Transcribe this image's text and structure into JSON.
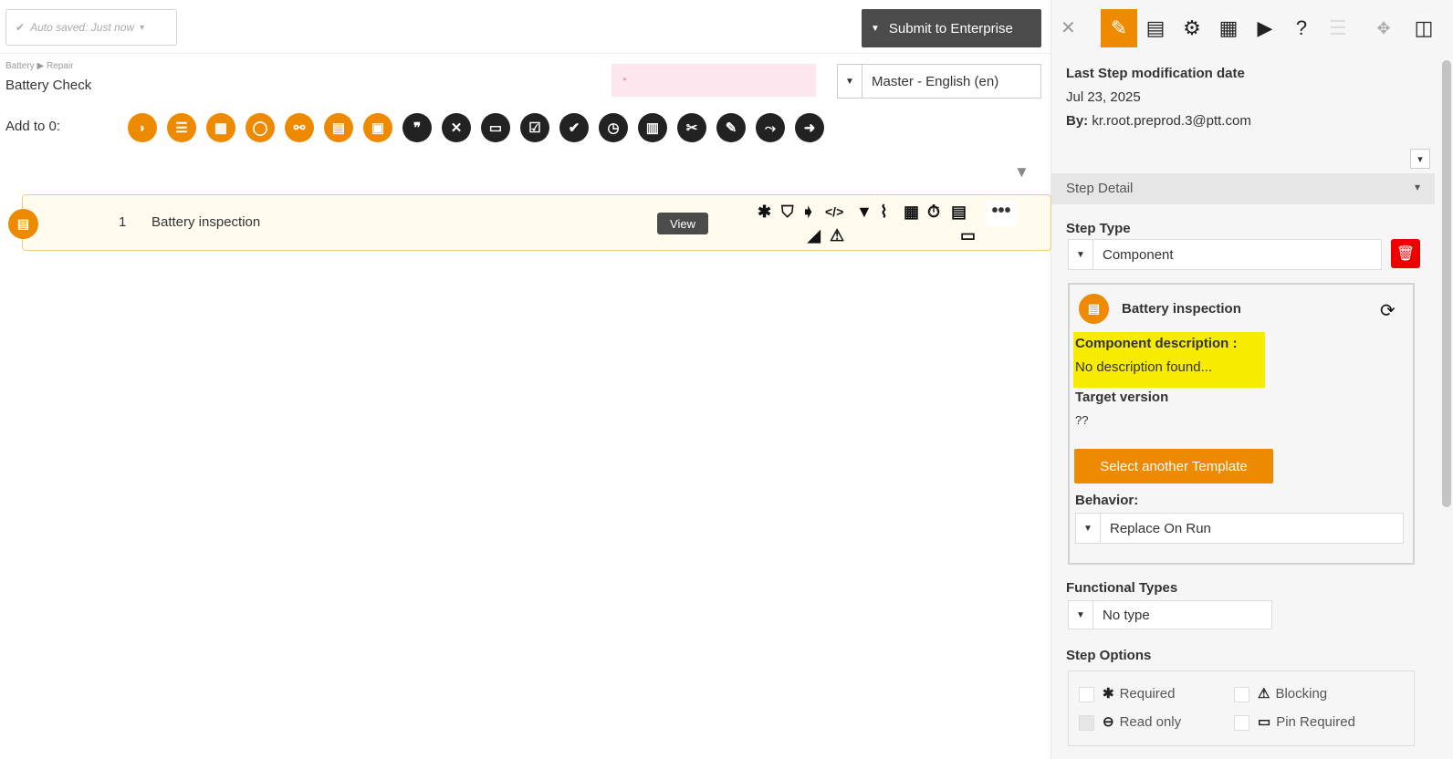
{
  "header": {
    "autosave_text": "Auto saved: Just now",
    "submit_label": "Submit to Enterprise"
  },
  "doc": {
    "breadcrumb": [
      "Battery",
      "Repair"
    ],
    "title": "Battery Check",
    "language": "Master - English (en)",
    "add_to_label": "Add to 0:"
  },
  "toolbar_icons": [
    {
      "name": "half-circle-icon",
      "glyph": "◗",
      "style": "o"
    },
    {
      "name": "list-icon",
      "glyph": "☰",
      "style": "o"
    },
    {
      "name": "table-icon",
      "glyph": "▦",
      "style": "o"
    },
    {
      "name": "circle-icon",
      "glyph": "◯",
      "style": "o"
    },
    {
      "name": "link-icon",
      "glyph": "⚯",
      "style": "o"
    },
    {
      "name": "calculator-icon",
      "glyph": "▤",
      "style": "o"
    },
    {
      "name": "film-icon",
      "glyph": "▣",
      "style": "o"
    },
    {
      "name": "quote-icon",
      "glyph": "❞",
      "style": "b"
    },
    {
      "name": "xor-icon",
      "glyph": "✕",
      "style": "b"
    },
    {
      "name": "card-icon",
      "glyph": "▭",
      "style": "b"
    },
    {
      "name": "checklist-icon",
      "glyph": "☑",
      "style": "b"
    },
    {
      "name": "checkbox-icon",
      "glyph": "✔",
      "style": "b"
    },
    {
      "name": "clock-icon",
      "glyph": "◷",
      "style": "b"
    },
    {
      "name": "calc-icon",
      "glyph": "▥",
      "style": "b"
    },
    {
      "name": "tools-icon",
      "glyph": "✂",
      "style": "b"
    },
    {
      "name": "edit-icon",
      "glyph": "✎",
      "style": "b"
    },
    {
      "name": "branch-icon",
      "glyph": "⤳",
      "style": "b"
    },
    {
      "name": "arrow-right-icon",
      "glyph": "➜",
      "style": "b"
    }
  ],
  "step": {
    "number": "1",
    "name": "Battery inspection",
    "view_label": "View",
    "more_label": "•••"
  },
  "step_row_icons": [
    {
      "name": "asterisk-icon",
      "glyph": "✱"
    },
    {
      "name": "shield-icon",
      "glyph": "⛉"
    },
    {
      "name": "tags-icon",
      "glyph": "➧"
    },
    {
      "name": "code-icon",
      "glyph": "</>"
    },
    {
      "name": "filter-icon",
      "glyph": "▼"
    },
    {
      "name": "paperclip-icon",
      "glyph": "⌇"
    },
    {
      "name": "grid-icon",
      "glyph": "▦"
    },
    {
      "name": "stopwatch-icon",
      "glyph": "⏱"
    },
    {
      "name": "list-grid-icon",
      "glyph": "▤"
    },
    {
      "name": "road-icon",
      "glyph": "◢"
    },
    {
      "name": "warning-icon",
      "glyph": "⚠"
    },
    {
      "name": "id-card-icon",
      "glyph": "▭"
    }
  ],
  "right_panel": {
    "tabs": [
      {
        "name": "edit-icon",
        "glyph": "✎"
      },
      {
        "name": "clipboard-icon",
        "glyph": "▤"
      },
      {
        "name": "gear-icon",
        "glyph": "⚙"
      },
      {
        "name": "document-icon",
        "glyph": "▦"
      },
      {
        "name": "play-icon",
        "glyph": "▶"
      },
      {
        "name": "help-icon",
        "glyph": "?"
      },
      {
        "name": "list-icon",
        "glyph": "☰"
      },
      {
        "name": "move-icon",
        "glyph": "✥"
      },
      {
        "name": "add-panel-icon",
        "glyph": "◫"
      }
    ],
    "last_mod_label": "Last Step modification date",
    "last_mod_date": "Jul 23, 2025",
    "by_label": "By:",
    "by_value": "kr.root.preprod.3@ptt.com",
    "step_detail_label": "Step Detail",
    "step_type_label": "Step Type",
    "step_type_value": "Component",
    "component_name": "Battery inspection",
    "component_desc_label": "Component description :",
    "component_desc_value": "No description found...",
    "target_version_label": "Target version",
    "target_version_value": "??",
    "select_template_label": "Select another Template",
    "behavior_label": "Behavior:",
    "behavior_value": "Replace On Run",
    "functional_types_label": "Functional Types",
    "functional_types_value": "No type",
    "step_options_label": "Step Options",
    "options": {
      "required": "Required",
      "blocking": "Blocking",
      "read_only": "Read only",
      "pin_required": "Pin Required"
    }
  },
  "colors": {
    "accent": "#ee8a00",
    "dark_button": "#4b4b4b",
    "highlight": "#f7ec00",
    "delete": "#ee0000"
  }
}
